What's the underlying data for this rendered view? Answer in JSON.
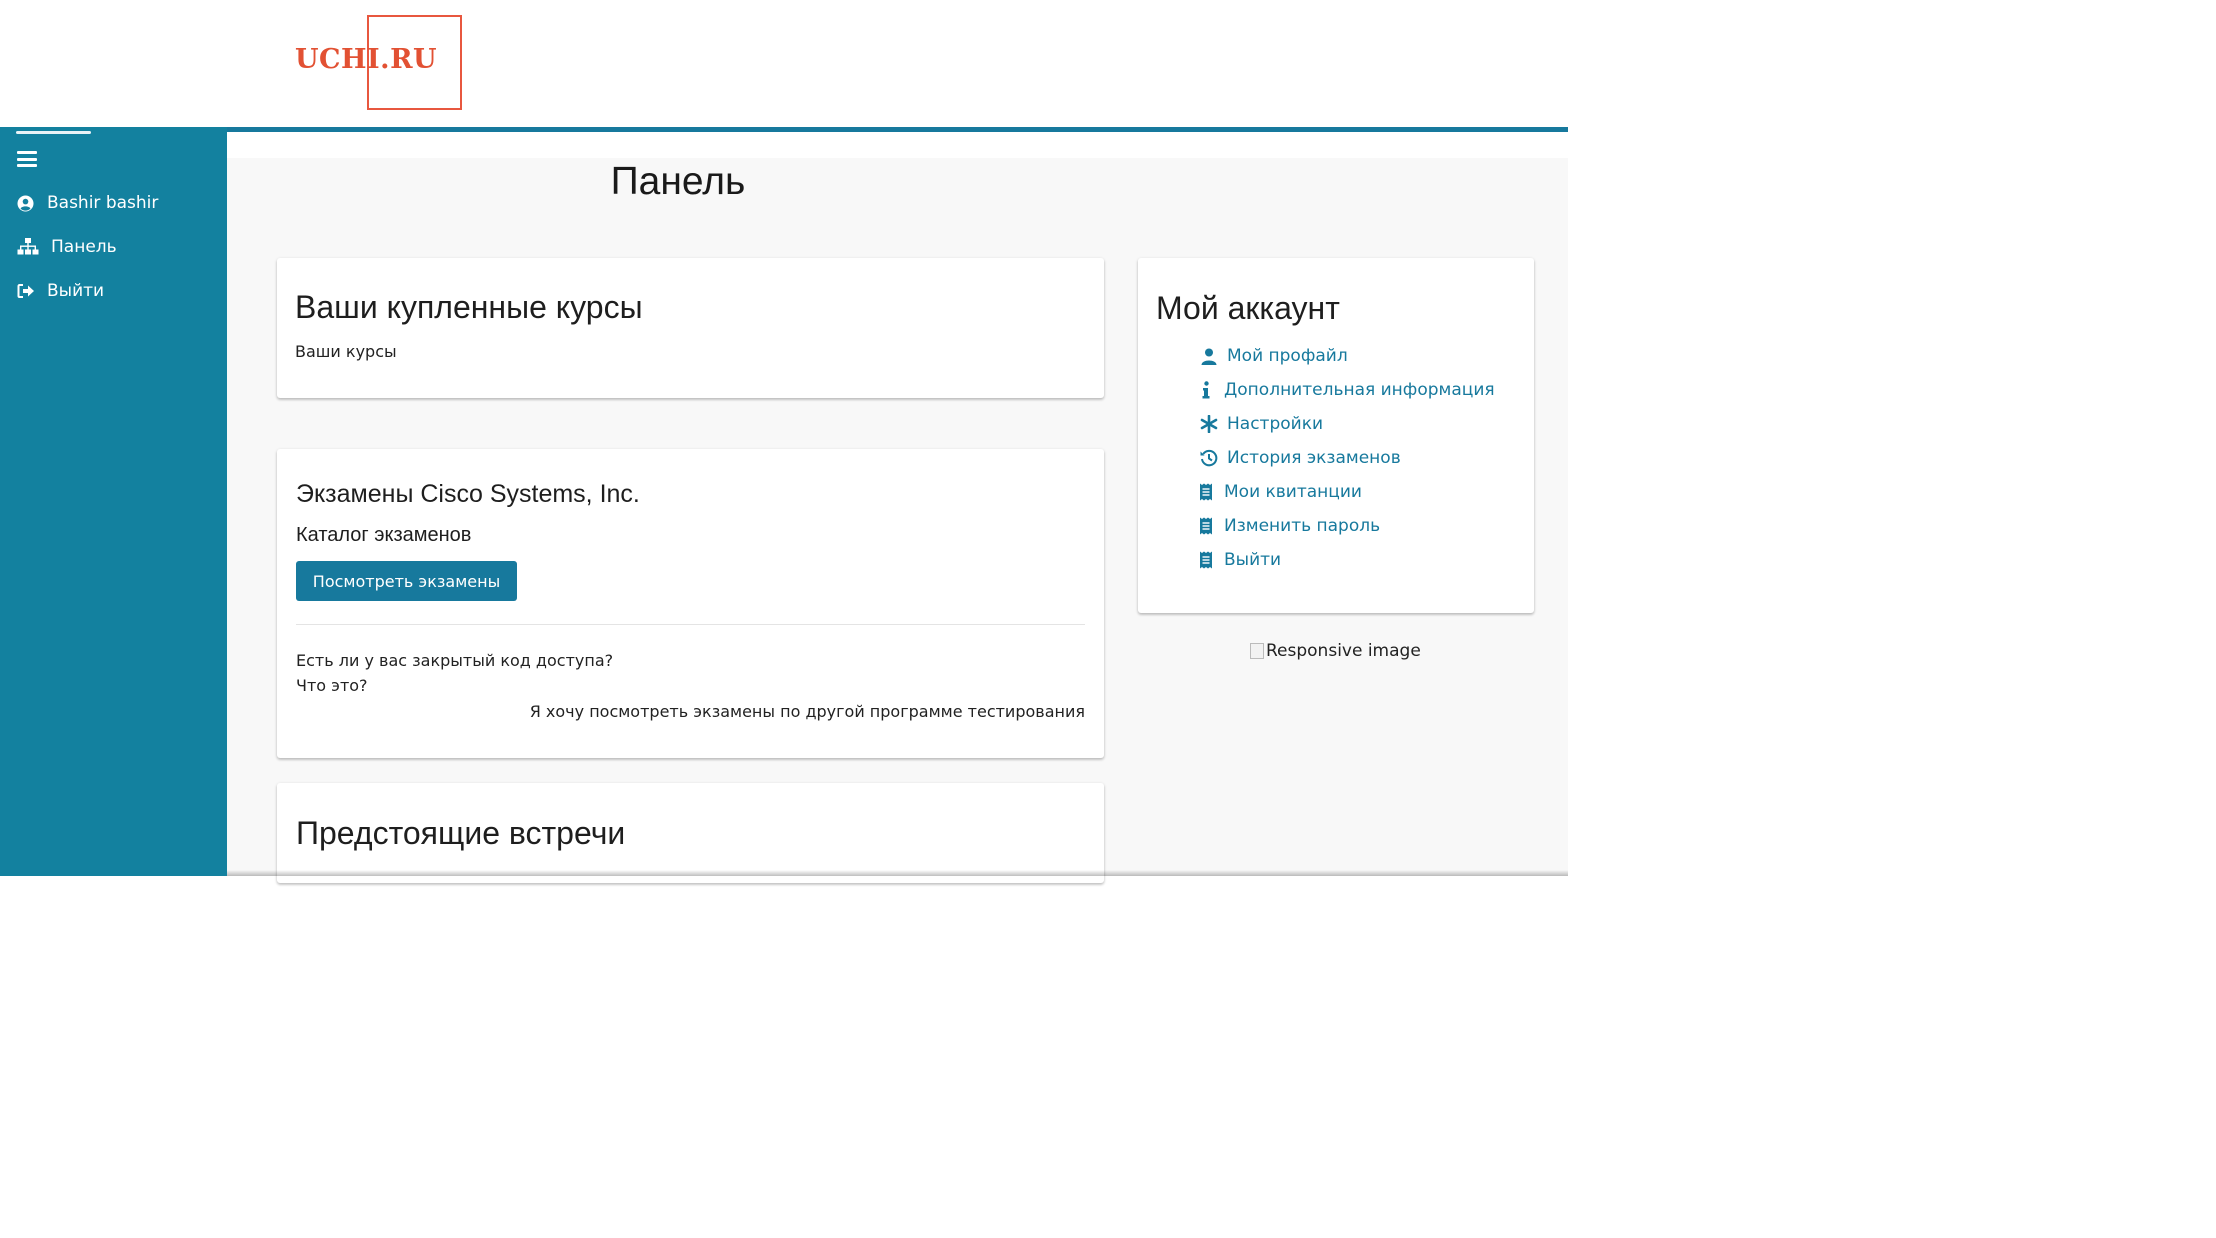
{
  "logo": {
    "text": "UCHI.RU",
    "color": "#e25133"
  },
  "colors": {
    "brand": "#17799d",
    "sidebar": "#13819f"
  },
  "sidebar": {
    "items": [
      {
        "label": "Bashir bashir",
        "icon": "user-circle-icon"
      },
      {
        "label": "Панель",
        "icon": "sitemap-icon"
      },
      {
        "label": "Выйти",
        "icon": "sign-out-icon"
      }
    ]
  },
  "page": {
    "title": "Панель"
  },
  "bought": {
    "title": "Ваши купленные курсы",
    "subtitle": "Ваши курсы"
  },
  "exams": {
    "title": "Экзамены Cisco Systems, Inc.",
    "catalog": "Каталог экзаменов",
    "button": "Посмотреть экзамены",
    "question": "Есть ли у вас закрытый код доступа?",
    "what": "Что это?",
    "other": "Я хочу посмотреть экзамены по другой программе тестирования"
  },
  "meetings": {
    "title": "Предстоящие встречи"
  },
  "account": {
    "title": "Мой аккаунт",
    "items": [
      {
        "label": "Мой профайл",
        "icon": "user-icon"
      },
      {
        "label": "Дополнительная информация",
        "icon": "info-icon"
      },
      {
        "label": "Настройки",
        "icon": "asterisk-icon"
      },
      {
        "label": "История экзаменов",
        "icon": "history-icon"
      },
      {
        "label": "Мои квитанции",
        "icon": "receipt-icon"
      },
      {
        "label": "Изменить пароль",
        "icon": "receipt-icon"
      },
      {
        "label": "Выйти",
        "icon": "receipt-icon"
      }
    ]
  },
  "responsive_image": {
    "alt": "Responsive image"
  }
}
